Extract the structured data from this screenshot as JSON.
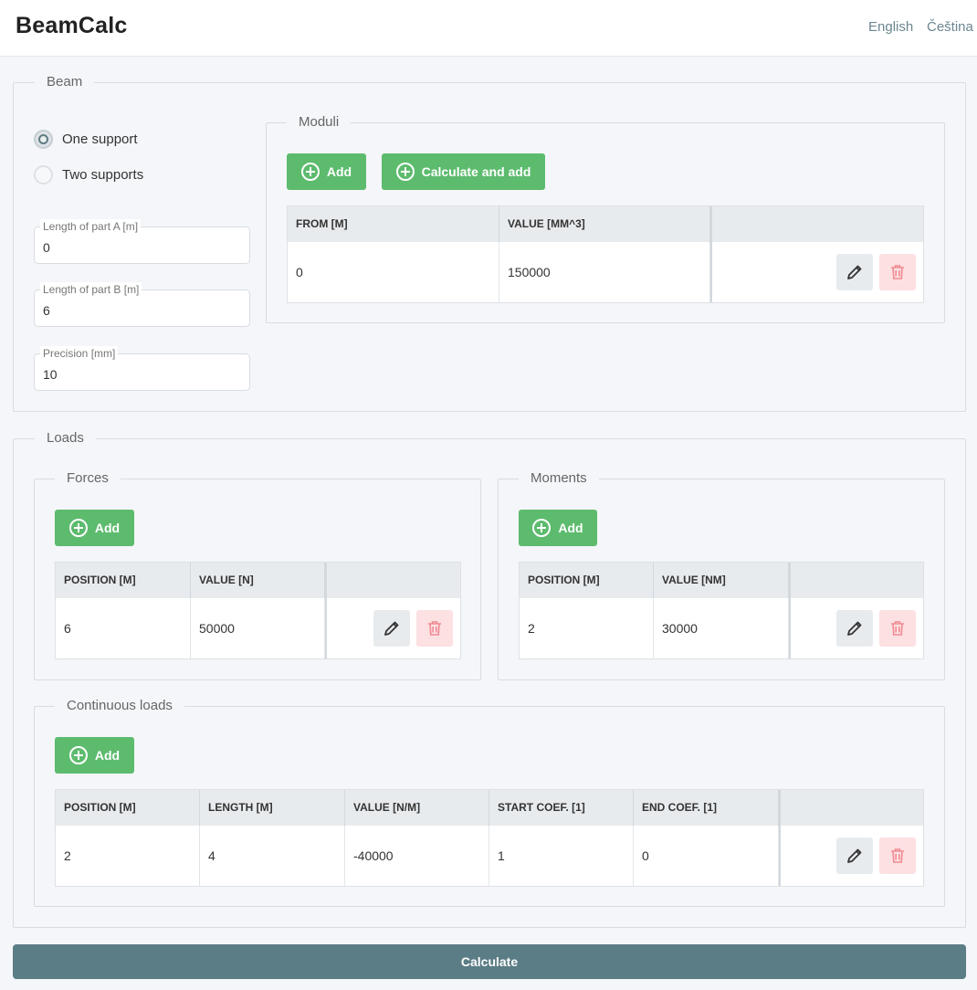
{
  "app": {
    "title": "BeamCalc",
    "languages": [
      "English",
      "Čeština"
    ]
  },
  "beam": {
    "legend": "Beam",
    "supports": [
      {
        "label": "One support",
        "checked": true
      },
      {
        "label": "Two supports",
        "checked": false
      }
    ],
    "fields": [
      {
        "label": "Length of part A [m]",
        "value": "0"
      },
      {
        "label": "Length of part B [m]",
        "value": "6"
      },
      {
        "label": "Precision [mm]",
        "value": "10"
      }
    ],
    "moduli": {
      "legend": "Moduli",
      "add_label": "Add",
      "calc_add_label": "Calculate and add",
      "columns": [
        "FROM [M]",
        "VALUE [MM^3]"
      ],
      "rows": [
        [
          "0",
          "150000"
        ]
      ]
    }
  },
  "loads": {
    "legend": "Loads",
    "forces": {
      "legend": "Forces",
      "add_label": "Add",
      "columns": [
        "POSITION [M]",
        "VALUE [N]"
      ],
      "rows": [
        [
          "6",
          "50000"
        ]
      ]
    },
    "moments": {
      "legend": "Moments",
      "add_label": "Add",
      "columns": [
        "POSITION [M]",
        "VALUE [NM]"
      ],
      "rows": [
        [
          "2",
          "30000"
        ]
      ]
    },
    "continuous": {
      "legend": "Continuous loads",
      "add_label": "Add",
      "columns": [
        "POSITION [M]",
        "LENGTH [M]",
        "VALUE [N/M]",
        "START COEF. [1]",
        "END COEF. [1]"
      ],
      "rows": [
        [
          "2",
          "4",
          "-40000",
          "1",
          "0"
        ]
      ]
    }
  },
  "calculate_label": "Calculate",
  "colors": {
    "accent_green": "#5dbb6e",
    "primary": "#5b7d85",
    "danger_light": "#fce0e2",
    "danger_icon": "#f08a92",
    "edit_icon": "#333333"
  },
  "icons": {
    "add": "plus-circle-icon",
    "edit": "pencil-icon",
    "delete": "trash-icon"
  }
}
